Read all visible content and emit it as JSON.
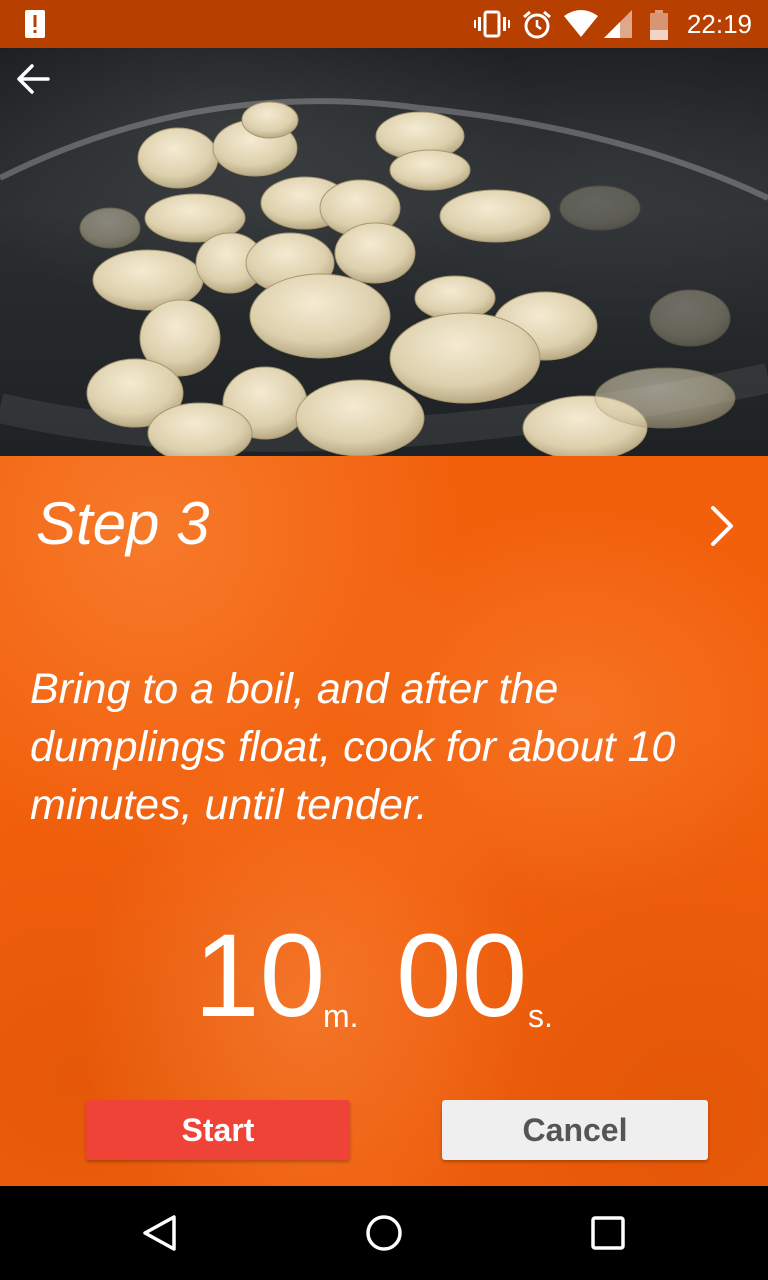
{
  "status_bar": {
    "time": "22:19",
    "icons": [
      "alert-icon",
      "vibrate-icon",
      "alarm-icon",
      "wifi-icon",
      "signal-icon",
      "battery-icon"
    ]
  },
  "step": {
    "title": "Step 3",
    "instruction": "Bring to a boil, and after the dumplings float, cook for about 10 minutes, until tender."
  },
  "timer": {
    "minutes": "10",
    "minutes_unit": "m.",
    "seconds": "00",
    "seconds_unit": "s."
  },
  "buttons": {
    "start": "Start",
    "cancel": "Cancel"
  },
  "colors": {
    "status_bar": "#b73f00",
    "panel": "#f2600c",
    "start_button": "#f04337",
    "cancel_button": "#efefef"
  },
  "hero_image": "boiling-dumplings-photo"
}
